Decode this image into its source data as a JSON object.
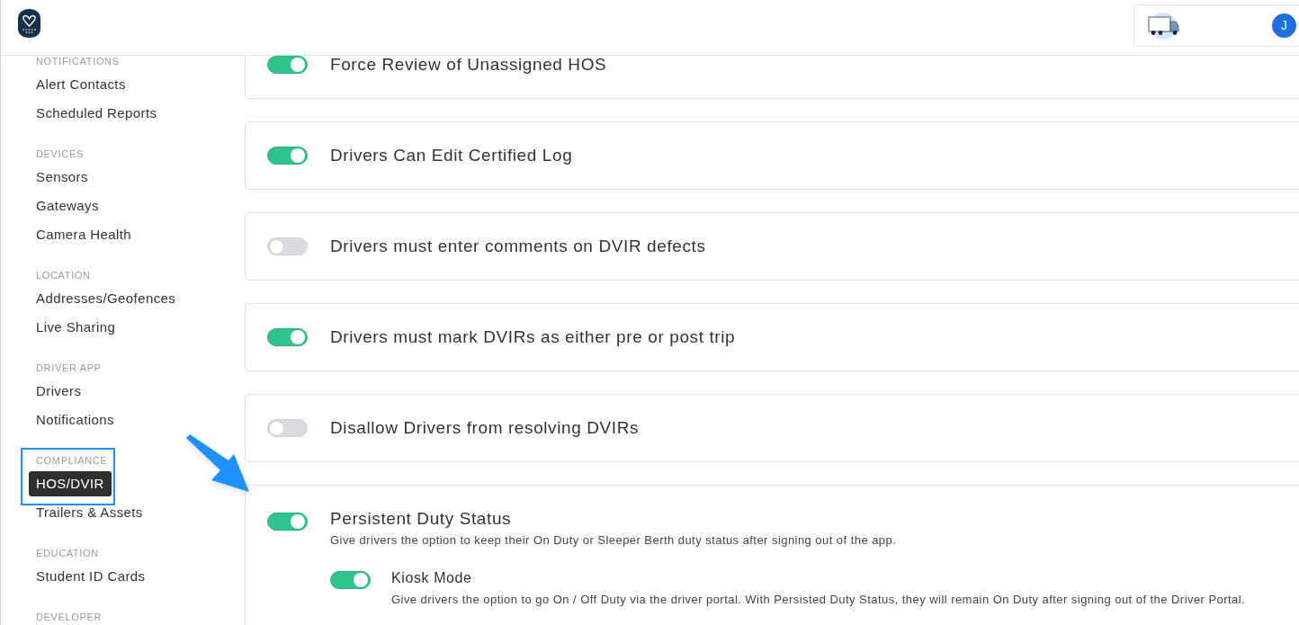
{
  "header": {
    "avatar": "J"
  },
  "sidebar": {
    "sections": [
      {
        "heading": "NOTIFICATIONS",
        "items": [
          {
            "label": "Alert Contacts",
            "selected": false
          },
          {
            "label": "Scheduled Reports",
            "selected": false
          }
        ]
      },
      {
        "heading": "DEVICES",
        "items": [
          {
            "label": "Sensors",
            "selected": false
          },
          {
            "label": "Gateways",
            "selected": false
          },
          {
            "label": "Camera Health",
            "selected": false
          }
        ]
      },
      {
        "heading": "LOCATION",
        "items": [
          {
            "label": "Addresses/Geofences",
            "selected": false
          },
          {
            "label": "Live Sharing",
            "selected": false
          }
        ]
      },
      {
        "heading": "DRIVER APP",
        "items": [
          {
            "label": "Drivers",
            "selected": false
          },
          {
            "label": "Notifications",
            "selected": false
          }
        ]
      },
      {
        "heading": "COMPLIANCE",
        "items": [
          {
            "label": "HOS/DVIR",
            "selected": true
          },
          {
            "label": "Trailers & Assets",
            "selected": false
          }
        ]
      },
      {
        "heading": "EDUCATION",
        "items": [
          {
            "label": "Student ID Cards",
            "selected": false
          }
        ]
      },
      {
        "heading": "DEVELOPER"
      }
    ]
  },
  "settings": [
    {
      "title": "Force Review of Unassigned HOS",
      "on": true
    },
    {
      "title": "Drivers Can Edit Certified Log",
      "on": true
    },
    {
      "title": "Drivers must enter comments on DVIR defects",
      "on": false
    },
    {
      "title": "Drivers must mark DVIRs as either pre or post trip",
      "on": true
    },
    {
      "title": "Disallow Drivers from resolving DVIRs",
      "on": false
    },
    {
      "title": "Persistent Duty Status",
      "on": true,
      "description": "Give drivers the option to keep their On Duty or Sleeper Berth duty status after signing out of the app.",
      "children": [
        {
          "title": "Kiosk Mode",
          "on": true,
          "description": "Give drivers the option to go On / Off Duty via the driver portal. With Persisted Duty Status, they will remain On Duty after signing out of the Driver Portal."
        }
      ]
    }
  ]
}
